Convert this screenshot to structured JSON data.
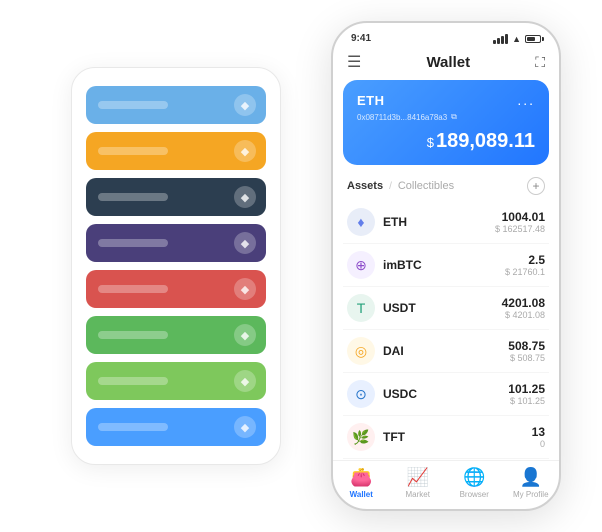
{
  "scene": {
    "cardStack": {
      "cards": [
        {
          "color": "#6ab0e8",
          "iconText": "◆"
        },
        {
          "color": "#f5a623",
          "iconText": "◆"
        },
        {
          "color": "#2c3e50",
          "iconText": "◆"
        },
        {
          "color": "#4a3f7a",
          "iconText": "◆"
        },
        {
          "color": "#d9534f",
          "iconText": "◆"
        },
        {
          "color": "#5cb85c",
          "iconText": "◆"
        },
        {
          "color": "#7ec85c",
          "iconText": "◆"
        },
        {
          "color": "#4a9eff",
          "iconText": "◆"
        }
      ]
    },
    "phone": {
      "statusBar": {
        "time": "9:41"
      },
      "header": {
        "menuIcon": "☰",
        "title": "Wallet",
        "expandIcon": "⛶"
      },
      "ethCard": {
        "title": "ETH",
        "dots": "...",
        "address": "0x08711d3b...8416a78a3",
        "copyIcon": "⧉",
        "dollarSign": "$",
        "amount": "189,089.11"
      },
      "assetsSection": {
        "activeTab": "Assets",
        "inactiveTab": "Collectibles",
        "divider": "/",
        "addIcon": "+"
      },
      "assets": [
        {
          "symbol": "ETH",
          "logoColor": "#e8edf8",
          "logoText": "♦",
          "logoTextColor": "#627eea",
          "amount": "1004.01",
          "usd": "$ 162517.48"
        },
        {
          "symbol": "imBTC",
          "logoColor": "#f5f0ff",
          "logoText": "⊕",
          "logoTextColor": "#8e4ecb",
          "amount": "2.5",
          "usd": "$ 21760.1"
        },
        {
          "symbol": "USDT",
          "logoColor": "#e8f5ef",
          "logoText": "T",
          "logoTextColor": "#26a17b",
          "amount": "4201.08",
          "usd": "$ 4201.08"
        },
        {
          "symbol": "DAI",
          "logoColor": "#fff8e6",
          "logoText": "◎",
          "logoTextColor": "#f5a623",
          "amount": "508.75",
          "usd": "$ 508.75"
        },
        {
          "symbol": "USDC",
          "logoColor": "#e8f0ff",
          "logoText": "⊙",
          "logoTextColor": "#2775ca",
          "amount": "101.25",
          "usd": "$ 101.25"
        },
        {
          "symbol": "TFT",
          "logoColor": "#fff0f0",
          "logoText": "🌿",
          "logoTextColor": "#e84393",
          "amount": "13",
          "usd": "0"
        }
      ],
      "bottomNav": [
        {
          "icon": "👛",
          "label": "Wallet",
          "active": true
        },
        {
          "icon": "📈",
          "label": "Market",
          "active": false
        },
        {
          "icon": "🌐",
          "label": "Browser",
          "active": false
        },
        {
          "icon": "👤",
          "label": "My Profile",
          "active": false
        }
      ]
    }
  }
}
